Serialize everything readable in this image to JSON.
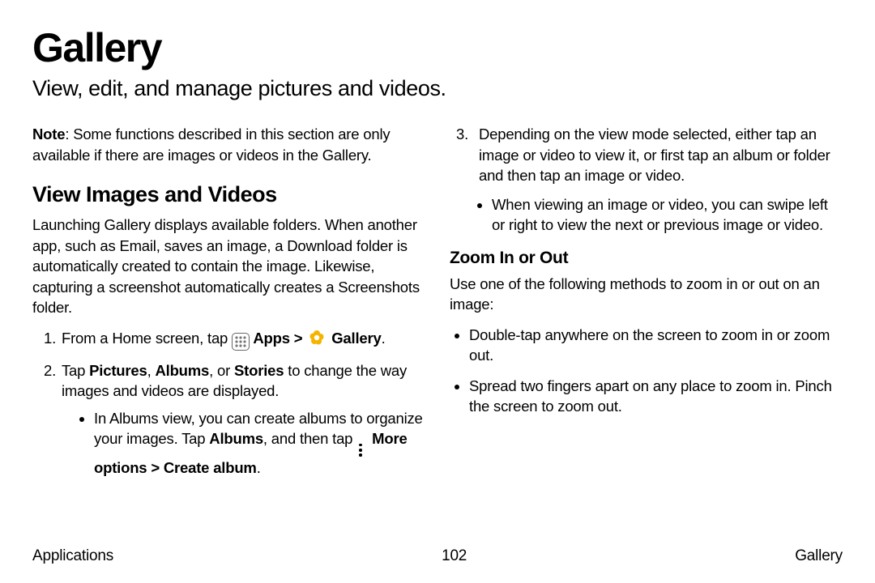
{
  "title": "Gallery",
  "subtitle": "View, edit, and manage pictures and videos.",
  "note_label": "Note",
  "note_text": ": Some functions described in this section are only available if there are images or videos in the Gallery.",
  "section1_heading": "View Images and Videos",
  "section1_para": "Launching Gallery displays available folders. When another app, such as Email, saves an image, a Download folder is automatically created to contain the image. Likewise, capturing a screenshot automatically creates a Screenshots folder.",
  "step1_pre": "From a Home screen, tap ",
  "step1_apps": " Apps",
  "step1_sep": " > ",
  "step1_gallery": " Gallery",
  "step1_post": ".",
  "step2_pre": "Tap ",
  "step2_b1": "Pictures",
  "step2_m1": ", ",
  "step2_b2": "Albums",
  "step2_m2": ", or ",
  "step2_b3": "Stories",
  "step2_post": " to change the way images and videos are displayed.",
  "step2_sub_pre": "In Albums view, you can create albums to organize your images. Tap ",
  "step2_sub_b1": "Albums",
  "step2_sub_m1": ", and then tap ",
  "step2_sub_b2": " More options > Create album",
  "step2_sub_post": ".",
  "col2_step3_num": "3.",
  "col2_step3_text": "Depending on the view mode selected, either tap an image or video to view it, or first tap an album or folder and then tap an image or video.",
  "col2_step3_sub": "When viewing an image or video, you can swipe left or right to view the next or previous image or video.",
  "zoom_heading": "Zoom In or Out",
  "zoom_para": "Use one of the following methods to zoom in or out on an image:",
  "zoom_b1": "Double-tap anywhere on the screen to zoom in or zoom out.",
  "zoom_b2": "Spread two fingers apart on any place to zoom in. Pinch the screen to zoom out.",
  "footer_left": "Applications",
  "footer_center": "102",
  "footer_right": "Gallery"
}
